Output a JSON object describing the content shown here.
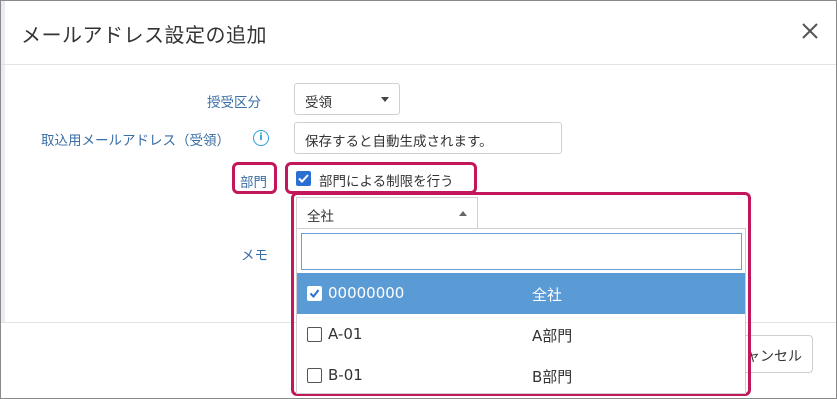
{
  "modal": {
    "title": "メールアドレス設定の追加"
  },
  "form": {
    "kubun_label": "授受区分",
    "kubun_value": "受領",
    "address_label": "取込用メールアドレス（受領）",
    "address_value": "保存すると自動生成されます。",
    "bumon_label": "部門",
    "bumon_checkbox_label": "部門による制限を行う",
    "bumon_checked": true,
    "memo_label": "メモ"
  },
  "dropdown": {
    "selected_value": "全社",
    "search_value": "",
    "options": [
      {
        "code": "00000000",
        "name": "全社",
        "checked": true
      },
      {
        "code": "A-01",
        "name": "A部門",
        "checked": false
      },
      {
        "code": "B-01",
        "name": "B部門",
        "checked": false
      }
    ]
  },
  "footer": {
    "cancel_label": "ャンセル"
  },
  "colors": {
    "label_blue": "#3a6ea5",
    "highlight": "#c2185b",
    "selected_row": "#5b9bd5",
    "checkbox": "#2a6fd1"
  }
}
